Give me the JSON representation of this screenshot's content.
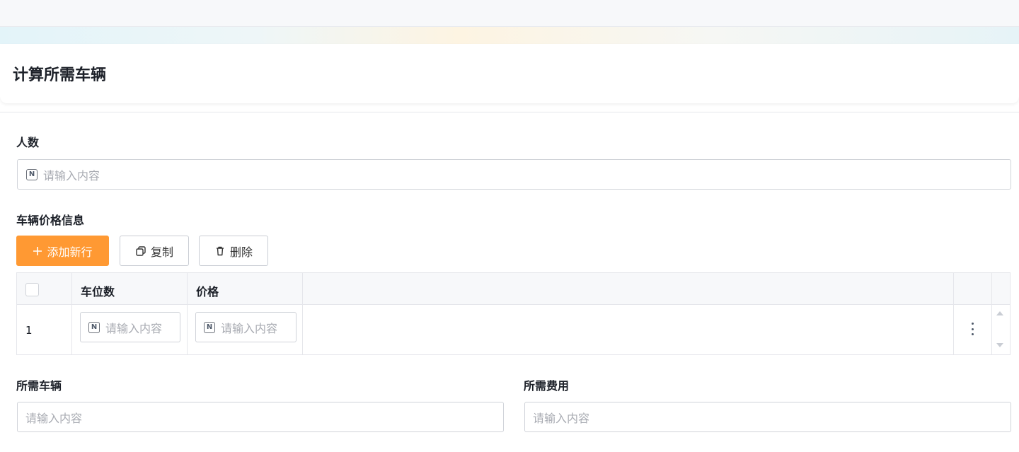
{
  "page": {
    "title": "计算所需车辆"
  },
  "form": {
    "people": {
      "label": "人数",
      "placeholder": "请输入内容"
    },
    "vehicle_price": {
      "label": "车辆价格信息",
      "buttons": {
        "add": "添加新行",
        "copy": "复制",
        "delete": "删除"
      },
      "columns": [
        "车位数",
        "价格"
      ],
      "rows": [
        {
          "index": "1",
          "seats_placeholder": "请输入内容",
          "price_placeholder": "请输入内容"
        }
      ]
    },
    "vehicles_needed": {
      "label": "所需车辆",
      "placeholder": "请输入内容"
    },
    "cost_needed": {
      "label": "所需费用",
      "placeholder": "请输入内容"
    }
  },
  "colors": {
    "primary": "#ff9933",
    "placeholder": "#a8abb2",
    "border": "#d0d3d9"
  },
  "icons": [
    "number-icon",
    "plus-icon",
    "copy-icon",
    "trash-icon",
    "more-vertical-icon",
    "scroll-up-icon",
    "scroll-down-icon"
  ]
}
